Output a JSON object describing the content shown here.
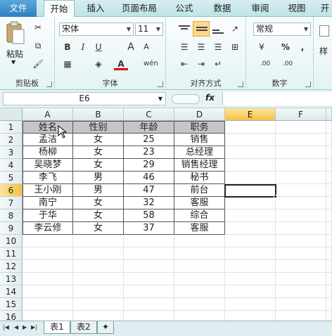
{
  "ribbon_tabs": [
    "文件",
    "开始",
    "插入",
    "页面布局",
    "公式",
    "数据",
    "审阅",
    "视图",
    "开"
  ],
  "clipboard": {
    "paste_label": "粘贴",
    "group_label": "剪贴板"
  },
  "font": {
    "name": "宋体",
    "size": "11",
    "group_label": "字体",
    "bold": "B",
    "italic": "I",
    "underline": "U",
    "grow": "A",
    "shrink": "A",
    "phonetic": "wén"
  },
  "alignment": {
    "group_label": "对齐方式"
  },
  "number": {
    "format": "常规",
    "group_label": "数字",
    "percent": "%",
    "comma": ",",
    "inc_decimal": ".00",
    "dec_decimal": ".00"
  },
  "styles": {
    "label": "样"
  },
  "formula_bar": {
    "name_box": "E6",
    "fx": "fx",
    "content": ""
  },
  "columns": [
    "A",
    "B",
    "C",
    "D",
    "E",
    "F"
  ],
  "rows": [
    "1",
    "2",
    "3",
    "4",
    "5",
    "6",
    "7",
    "8",
    "9",
    "10",
    "11",
    "12",
    "13",
    "14",
    "15",
    "16"
  ],
  "table": {
    "headers": [
      "姓名",
      "性别",
      "年龄",
      "职务"
    ],
    "rows": [
      [
        "孟洁",
        "女",
        "25",
        "销售"
      ],
      [
        "杨柳",
        "女",
        "23",
        "总经理"
      ],
      [
        "吴晓梦",
        "女",
        "29",
        "销售经理"
      ],
      [
        "李飞",
        "男",
        "46",
        "秘书"
      ],
      [
        "王小刚",
        "男",
        "47",
        "前台"
      ],
      [
        "南宁",
        "女",
        "32",
        "客服"
      ],
      [
        "于华",
        "女",
        "58",
        "综合"
      ],
      [
        "李云修",
        "女",
        "37",
        "客服"
      ]
    ]
  },
  "active_cell": "E6",
  "sheets": [
    "表1",
    "表2"
  ],
  "colors": {
    "accent": "#2e7fc1",
    "header_fill": "#c5c5c5",
    "ribbon_bg": "#e4f3f4",
    "active_header": "#f5c242"
  }
}
